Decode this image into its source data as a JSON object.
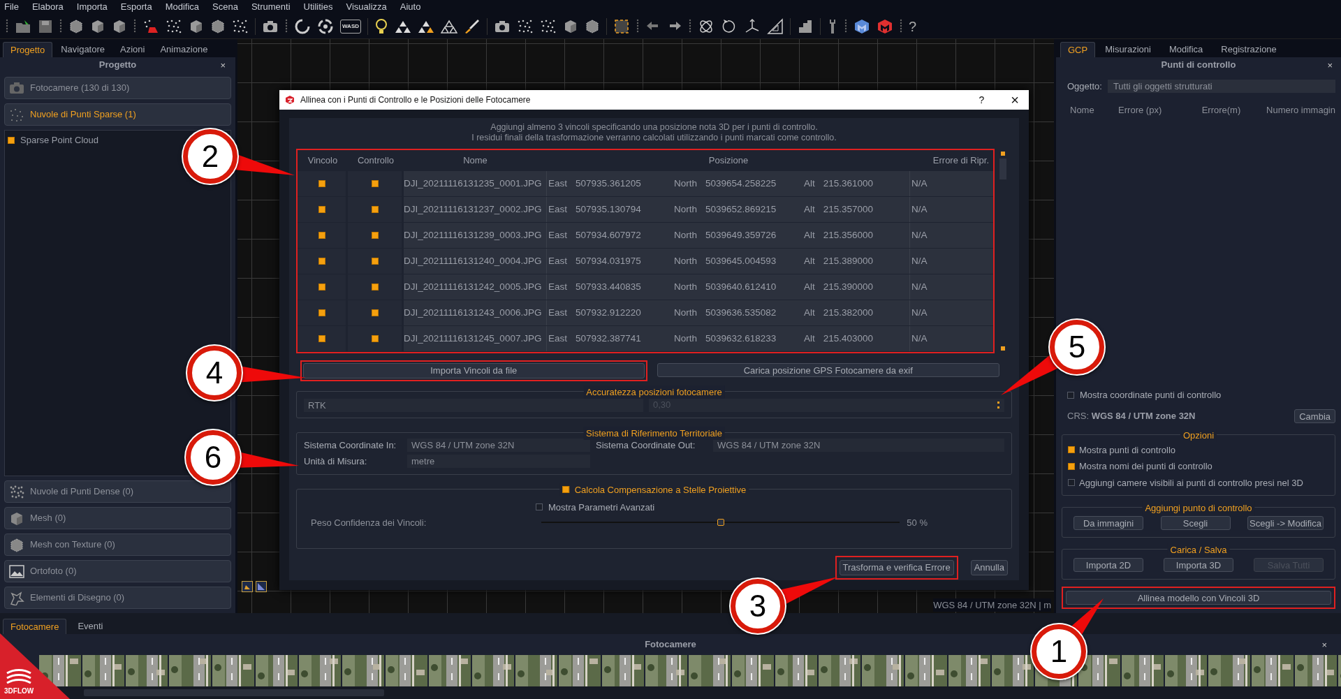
{
  "menu": [
    "File",
    "Elabora",
    "Importa",
    "Esporta",
    "Modifica",
    "Scena",
    "Strumenti",
    "Utilities",
    "Visualizza",
    "Aiuto"
  ],
  "toolbar": {
    "wasd_label": "WASD",
    "help": "?"
  },
  "left_panel": {
    "tabs": [
      {
        "label": "Progetto",
        "selected": true
      },
      {
        "label": "Navigatore",
        "selected": false
      },
      {
        "label": "Azioni",
        "selected": false
      },
      {
        "label": "Animazione",
        "selected": false
      }
    ],
    "title": "Progetto",
    "close": "×",
    "sections": [
      {
        "kind": "camera",
        "label": "Fotocamere (130 di 130)",
        "expanded": false
      },
      {
        "kind": "sparse",
        "label": "Nuvole di Punti Sparse (1)",
        "expanded": true,
        "children": [
          {
            "label": "Sparse Point Cloud",
            "checked": true
          }
        ]
      },
      {
        "kind": "dense",
        "label": "Nuvole di Punti Dense (0)",
        "expanded": false
      },
      {
        "kind": "mesh",
        "label": "Mesh (0)",
        "expanded": false
      },
      {
        "kind": "texture",
        "label": "Mesh con Texture (0)",
        "expanded": false
      },
      {
        "kind": "ortho",
        "label": "Ortofoto (0)",
        "expanded": false
      },
      {
        "kind": "drawing",
        "label": "Elementi di Disegno (0)",
        "expanded": false
      }
    ]
  },
  "viewport": {
    "status": "WGS 84 / UTM zone 32N | m"
  },
  "dialog": {
    "title": "Allinea con i Punti di Controllo e le Posizioni delle Fotocamere",
    "help": "?",
    "close": "×",
    "instructions": [
      "Aggiungi almeno 3 vincoli specificando una posizione nota 3D per i punti di controllo.",
      "I residui finali della trasformazione verranno calcolati utilizzando i punti marcati come controllo."
    ],
    "columns": [
      "Vincolo",
      "Controllo",
      "Nome",
      "Posizione",
      "Errore di Ripr."
    ],
    "rows": [
      {
        "vincolo": true,
        "controllo": true,
        "nome": "DJI_20211116131235_0001.JPG",
        "east_label": "East",
        "east": "507935.361205",
        "north_label": "North",
        "north": "5039654.258225",
        "alt_label": "Alt",
        "alt": "215.361000",
        "errore": "N/A"
      },
      {
        "vincolo": true,
        "controllo": true,
        "nome": "DJI_20211116131237_0002.JPG",
        "east_label": "East",
        "east": "507935.130794",
        "north_label": "North",
        "north": "5039652.869215",
        "alt_label": "Alt",
        "alt": "215.357000",
        "errore": "N/A"
      },
      {
        "vincolo": true,
        "controllo": true,
        "nome": "DJI_20211116131239_0003.JPG",
        "east_label": "East",
        "east": "507934.607972",
        "north_label": "North",
        "north": "5039649.359726",
        "alt_label": "Alt",
        "alt": "215.356000",
        "errore": "N/A"
      },
      {
        "vincolo": true,
        "controllo": true,
        "nome": "DJI_20211116131240_0004.JPG",
        "east_label": "East",
        "east": "507934.031975",
        "north_label": "North",
        "north": "5039645.004593",
        "alt_label": "Alt",
        "alt": "215.389000",
        "errore": "N/A"
      },
      {
        "vincolo": true,
        "controllo": true,
        "nome": "DJI_20211116131242_0005.JPG",
        "east_label": "East",
        "east": "507933.440835",
        "north_label": "North",
        "north": "5039640.612410",
        "alt_label": "Alt",
        "alt": "215.390000",
        "errore": "N/A"
      },
      {
        "vincolo": true,
        "controllo": true,
        "nome": "DJI_20211116131243_0006.JPG",
        "east_label": "East",
        "east": "507932.912220",
        "north_label": "North",
        "north": "5039636.535082",
        "alt_label": "Alt",
        "alt": "215.382000",
        "errore": "N/A"
      },
      {
        "vincolo": true,
        "controllo": true,
        "nome": "DJI_20211116131245_0007.JPG",
        "east_label": "East",
        "east": "507932.387741",
        "north_label": "North",
        "north": "5039632.618233",
        "alt_label": "Alt",
        "alt": "215.403000",
        "errore": "N/A"
      }
    ],
    "import_buttons": [
      "Importa Vincoli da file",
      "Carica posizione GPS Fotocamere da exif"
    ],
    "accuracy": {
      "title": "Accuratezza posizioni fotocamere",
      "mode": "RTK",
      "value": "0,30"
    },
    "crs": {
      "title": "Sistema di Riferimento Territoriale",
      "in_label": "Sistema Coordinate In:",
      "in_value": "WGS 84 / UTM zone 32N",
      "out_label": "Sistema Coordinate Out:",
      "out_value": "WGS 84 / UTM zone 32N",
      "unit_label": "Unità di Misura:",
      "unit_value": "metre"
    },
    "compensation": {
      "title": "Calcola Compensazione a Stelle Proiettive",
      "checked": true,
      "advanced_label": "Mostra Parametri Avanzati",
      "advanced_checked": false,
      "weight_label": "Peso Confidenza dei Vincoli:",
      "level": 0.5,
      "reading": "50 %"
    },
    "buttons": [
      "Trasforma e verifica Errore",
      "Annulla"
    ]
  },
  "right_panel": {
    "tabs": [
      {
        "label": "GCP",
        "selected": true
      },
      {
        "label": "Misurazioni",
        "selected": false
      },
      {
        "label": "Modifica",
        "selected": false
      },
      {
        "label": "Registrazione",
        "selected": false
      }
    ],
    "title": "Punti di controllo",
    "close": "×",
    "object_label": "Oggetto:",
    "object_value": "Tutti gli oggetti strutturati",
    "columns": [
      "Nome",
      "Errore (px)",
      "Errore(m)",
      "Numero immagin"
    ],
    "show_coords": {
      "label": "Mostra coordinate punti di controllo",
      "checked": false
    },
    "crs_label": "CRS:",
    "crs_value": "WGS 84 / UTM zone 32N",
    "change_button": "Cambia",
    "options": {
      "title": "Opzioni",
      "items": [
        {
          "label": "Mostra punti di controllo",
          "checked": true
        },
        {
          "label": "Mostra nomi dei punti di controllo",
          "checked": true
        },
        {
          "label": "Aggiungi camere visibili ai punti di controllo presi nel 3D",
          "checked": false
        }
      ]
    },
    "add_group": {
      "title": "Aggiungi punto di controllo",
      "buttons": [
        {
          "label": "Da immagini",
          "disabled": false
        },
        {
          "label": "Scegli",
          "disabled": false
        },
        {
          "label": "Scegli -> Modifica",
          "disabled": false
        }
      ]
    },
    "load_group": {
      "title": "Carica / Salva",
      "buttons": [
        {
          "label": "Importa 2D",
          "disabled": false
        },
        {
          "label": "Importa 3D",
          "disabled": false
        },
        {
          "label": "Salva Tutti",
          "disabled": true
        }
      ]
    },
    "align_button": "Allinea modello con Vincoli 3D"
  },
  "bottom": {
    "tabs": [
      {
        "label": "Fotocamere",
        "selected": true
      },
      {
        "label": "Eventi",
        "selected": false
      }
    ],
    "title": "Fotocamere",
    "close": "×",
    "logo": "3DFLOW"
  },
  "callouts": [
    "1",
    "2",
    "3",
    "4",
    "5",
    "6"
  ]
}
